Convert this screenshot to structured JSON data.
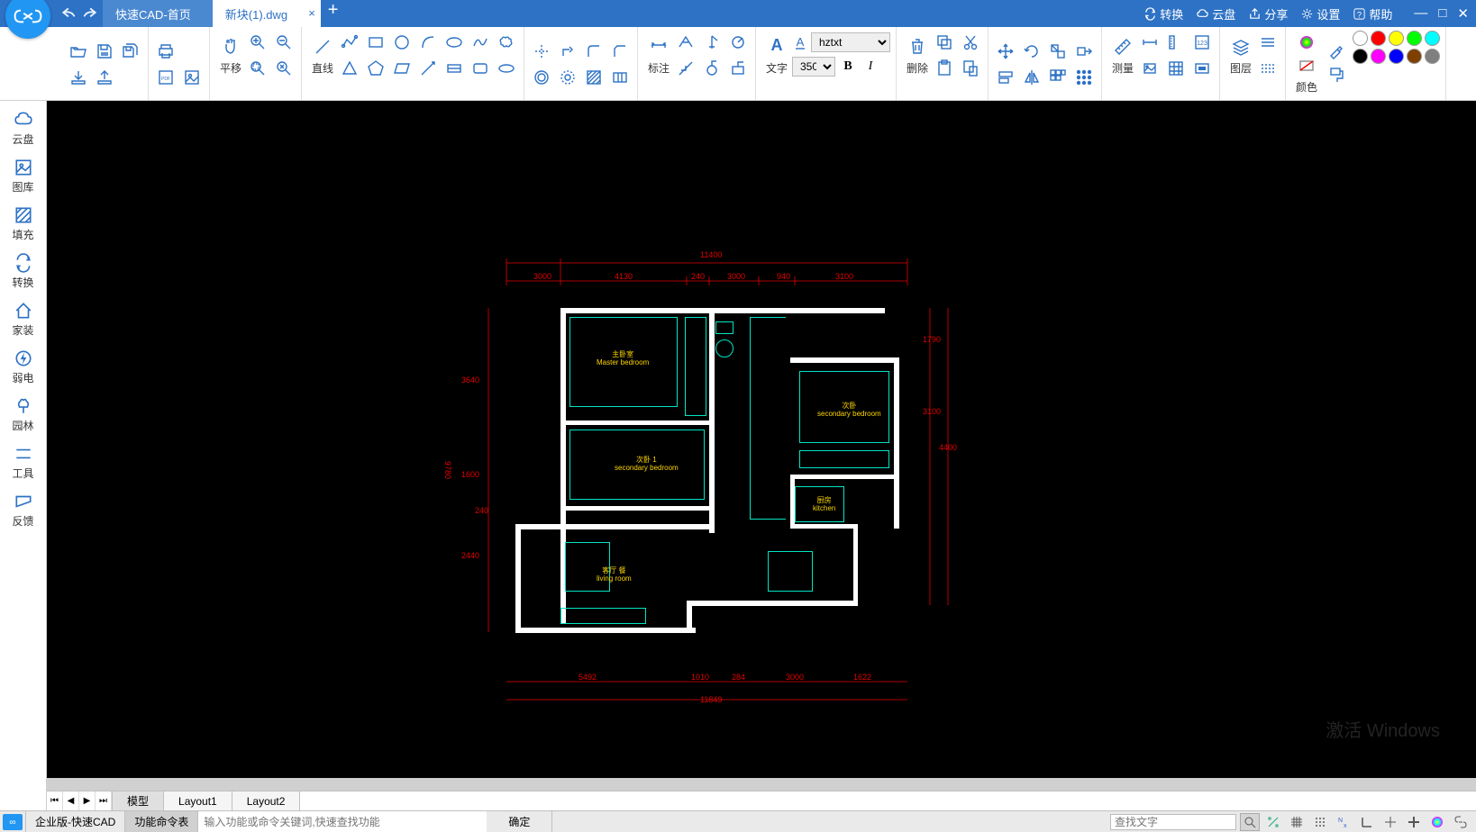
{
  "tabs": [
    {
      "label": "快速CAD-首页",
      "active": false
    },
    {
      "label": "新块(1).dwg",
      "active": true
    }
  ],
  "titleRight": [
    {
      "icon": "refresh",
      "label": "转换"
    },
    {
      "icon": "cloud",
      "label": "云盘"
    },
    {
      "icon": "share",
      "label": "分享"
    },
    {
      "icon": "gear",
      "label": "设置"
    },
    {
      "icon": "help",
      "label": "帮助"
    }
  ],
  "ribbon": {
    "pan": "平移",
    "line": "直线",
    "annotate": "标注",
    "text": "文字",
    "del": "删除",
    "measure": "测量",
    "layer": "图层",
    "color": "颜色",
    "font": "hztxt",
    "size": "350",
    "bold": "B",
    "italic": "I"
  },
  "left": [
    {
      "t": "云盘"
    },
    {
      "t": "图库"
    },
    {
      "t": "填充"
    },
    {
      "t": "转换"
    },
    {
      "t": "家装"
    },
    {
      "t": "弱电"
    },
    {
      "t": "园林"
    },
    {
      "t": "工具"
    },
    {
      "t": "反馈"
    }
  ],
  "layouts": [
    "模型",
    "Layout1",
    "Layout2"
  ],
  "status": {
    "ver": "企业版-快速CAD",
    "cmd": "功能命令表",
    "ph": "输入功能或命令关键词,快速查找功能",
    "ok": "确定",
    "search_ph": "查找文字"
  },
  "rooms": {
    "master": "主卧室\nMaster bedroom",
    "sec": "次卧\nsecondary bedroom",
    "sec1": "次卧 1\nsecondary bedroom",
    "kitchen": "厨房\nkitchen",
    "living": "客厅 餐\nliving room"
  },
  "dims": {
    "top_total": "11400",
    "t1": "3000",
    "t2": "4130",
    "t3": "240",
    "t4": "3000",
    "t5": "940",
    "t6": "3100",
    "l1": "3640",
    "l2": "1600",
    "l3": "240",
    "l4": "2440",
    "l_total": "9780",
    "r1": "1790",
    "r2": "3100",
    "r3": "4400",
    "b1": "5492",
    "b2": "1010",
    "b3": "284",
    "b4": "3000",
    "b5": "1622",
    "bot_total": "11849"
  },
  "colors": [
    "#ffffff",
    "#ff0000",
    "#ffff00",
    "#00ff00",
    "#00ffff",
    "#000000",
    "#ff00ff",
    "#0000ff",
    "#7f7f7f",
    "#00c5ff"
  ],
  "watermark": "激活 Windows"
}
